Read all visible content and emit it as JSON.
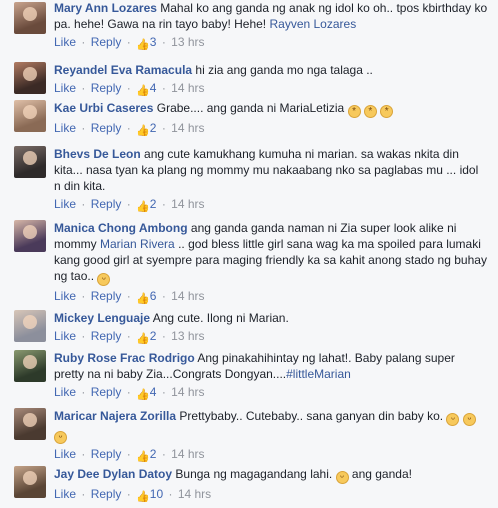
{
  "actions": {
    "like": "Like",
    "reply": "Reply",
    "dot": "·",
    "like_icon": "thumbs-up-icon"
  },
  "comments": [
    {
      "author": "Mary Ann Lozares",
      "text": "Mahal ko ang ganda ng anak ng idol ko oh.. tpos kbirthday ko pa. hehe! Gawa na rin tayo baby! Hehe!",
      "mention": "Rayven Lozares",
      "likes": "3",
      "time": "13 hrs",
      "avatar": [
        "#6a4b3c",
        "#c9a48e"
      ]
    },
    {
      "author": "Reyandel Eva Ramacula",
      "text": "hi zia ang ganda mo nga talaga ..",
      "likes": "4",
      "time": "14 hrs",
      "avatar": [
        "#3b2a25",
        "#b27c63"
      ]
    },
    {
      "author": "Kae Urbi Caseres",
      "text": "Grabe.... ang ganda ni MariaLetizia",
      "likes": "2",
      "time": "14 hrs",
      "avatar": [
        "#8a6a55",
        "#e0c0a8"
      ]
    },
    {
      "author": "Bhevs De Leon",
      "text": "ang cute kamukhang kumuha ni marian. sa wakas nkita din kita... nasa tyan ka plang ng mommy mu nakaabang nko sa paglabas mu ... idol n din kita.",
      "likes": "2",
      "time": "14 hrs",
      "avatar": [
        "#2e2a2a",
        "#7b6d68"
      ]
    },
    {
      "author": "Manica Chong Ambong",
      "text": "ang ganda ganda naman ni Zia super look alike ni mommy",
      "mention": "Marian Rivera",
      "text2": ".. god bless little girl sana wag ka ma spoiled para lumaki kang good girl at syempre para maging friendly ka sa kahit anong stado ng buhay ng tao..",
      "likes": "6",
      "time": "14 hrs",
      "avatar": [
        "#4a3a5a",
        "#d7b7a8"
      ]
    },
    {
      "author": "Mickey Lenguaje",
      "text": "Ang cute. Ilong ni Marian.",
      "likes": "2",
      "time": "13 hrs",
      "avatar": [
        "#8c8f9c",
        "#d8c6b8"
      ]
    },
    {
      "author": "Ruby Rose Frac Rodrigo",
      "text": "Ang pinakahihintay ng lahat!. Baby palang super pretty na ni baby Zia...Congrats Dongyan....",
      "mention": "#littleMarian",
      "likes": "4",
      "time": "14 hrs",
      "avatar": [
        "#2d3a2a",
        "#8a9a70"
      ]
    },
    {
      "author": "Maricar Najera Zorilla",
      "text": "Prettybaby.. Cutebaby.. sana ganyan din baby ko.",
      "likes": "2",
      "time": "14 hrs",
      "avatar": [
        "#4a3a30",
        "#a88a7a"
      ]
    },
    {
      "author": "Jay Dee Dylan Datoy",
      "text": "Bunga ng magagandang lahi.",
      "text2": "ang ganda!",
      "likes": "10",
      "time": "14 hrs",
      "avatar": [
        "#5a4535",
        "#c5a48a"
      ]
    }
  ]
}
